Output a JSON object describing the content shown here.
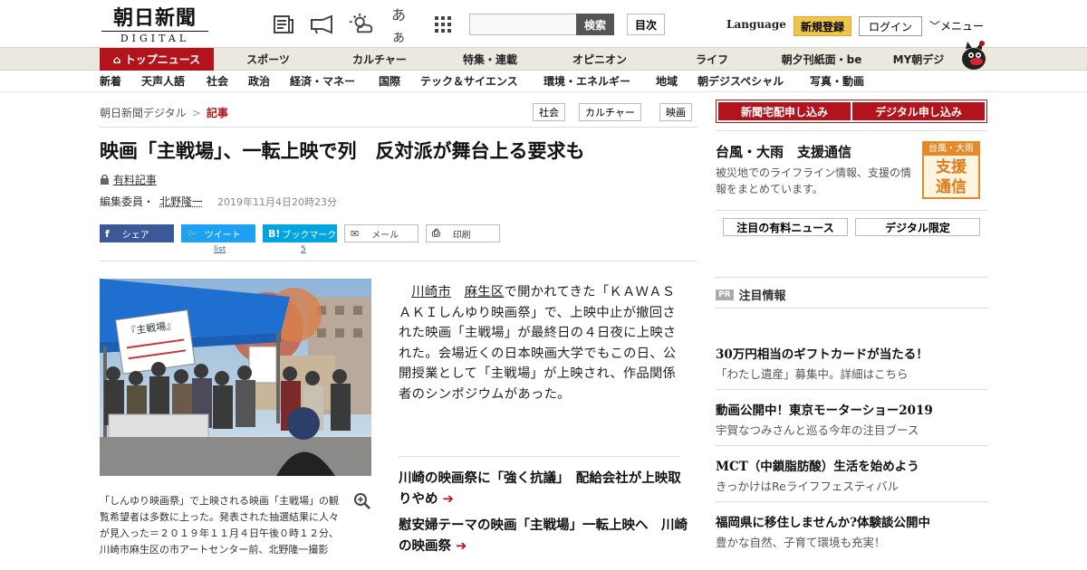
{
  "header": {
    "logo_jp": "朝日新聞",
    "logo_en": "DIGITAL",
    "icons": [
      "newspaper-icon",
      "megaphone-icon",
      "weather-icon",
      "font-size-icon",
      "grid-icon"
    ],
    "font_icon_text": "あぁ",
    "search_button": "検索",
    "mokuji_button": "目次",
    "language": "Language",
    "register": "新規登録",
    "login": "ログイン",
    "menu": "メニュー"
  },
  "nav_primary": [
    "トップニュース",
    "スポーツ",
    "カルチャー",
    "特集・連載",
    "オピニオン",
    "ライフ",
    "朝夕刊紙面・be",
    "MY朝デジ"
  ],
  "nav_secondary": [
    "新着",
    "天声人語",
    "社会",
    "政治",
    "経済・マネー",
    "国際",
    "テック＆サイエンス",
    "環境・エネルギー",
    "地域",
    "朝デジスペシャル",
    "写真・動画"
  ],
  "breadcrumb": {
    "home": "朝日新聞デジタル",
    "sep": ">",
    "current": "記事"
  },
  "tags": [
    "社会",
    "カルチャー",
    "映画"
  ],
  "article": {
    "headline": "映画「主戦場」、一転上映で列　反対派が舞台上る要求も",
    "paid_label": "有料記事",
    "byline_role": "編集委員・",
    "author": "北野隆一",
    "date": "2019年11月4日20時23分",
    "caption": "「しんゆり映画祭」で上映される映画「主戦場」の観覧希望者は多数に上った。発表された抽選結果に人々が見入った＝２０１９年１１月４日午後０時１２分、川崎市麻生区の市アートセンター前、北野隆一撮影",
    "body_link1": "川崎市",
    "body_link2": "麻生区",
    "body_rest": "で開かれてきた「ＫＡＷＡＳＡＫＩしんゆり映画祭」で、上映中止が撤回された映画「主戦場」が最終日の４日夜に上映された。会場近くの日本映画大学でもこの日、公開授業として「主戦場」が上映され、作品関係者のシンポジウムがあった。",
    "related": [
      "川崎の映画祭に「強く抗議」　配給会社が上映取りやめ",
      "慰安婦テーマの映画「主戦場」一転上映へ　川崎の映画祭"
    ]
  },
  "share": {
    "facebook": "シェア",
    "twitter": "ツイート",
    "twitter_count": "list",
    "hatena": "ブックマーク",
    "hatena_count": "5",
    "mail": "メール",
    "print": "印刷"
  },
  "photo_sign": "『主戦場』",
  "sidebar": {
    "subscribe_paper": "新聞宅配申し込み",
    "subscribe_digital": "デジタル申し込み",
    "typhoon_title": "台風・大雨　支援通信",
    "typhoon_desc": "被災地でのライフライン情報、支援の情報をまとめています。",
    "typhoon_badge_top": "台風・大雨",
    "typhoon_badge_main": "支援通信",
    "btn_paid_news": "注目の有料ニュース",
    "btn_digital_only": "デジタル限定",
    "pr_badge": "PR",
    "pr_title": "注目情報",
    "ads": [
      {
        "title": "30万円相当のギフトカードが当たる！",
        "sub": "「わたし遺産」募集中。詳細はこちら"
      },
      {
        "title": "動画公開中！東京モーターショー2019",
        "sub": "宇賀なつみさんと巡る今年の注目ブース"
      },
      {
        "title": "MCT（中鎖脂肪酸）生活を始めよう",
        "sub": "きっかけはReライフフェスティバル"
      },
      {
        "title": "福岡県に移住しませんか?体験談公開中",
        "sub": "豊かな自然、子育て環境も充実！"
      }
    ]
  },
  "colors": {
    "brand_red": "#b3131a",
    "facebook": "#3b5998",
    "twitter": "#1da1f2",
    "hatena": "#00a4de",
    "register_yellow": "#f0c64a"
  }
}
